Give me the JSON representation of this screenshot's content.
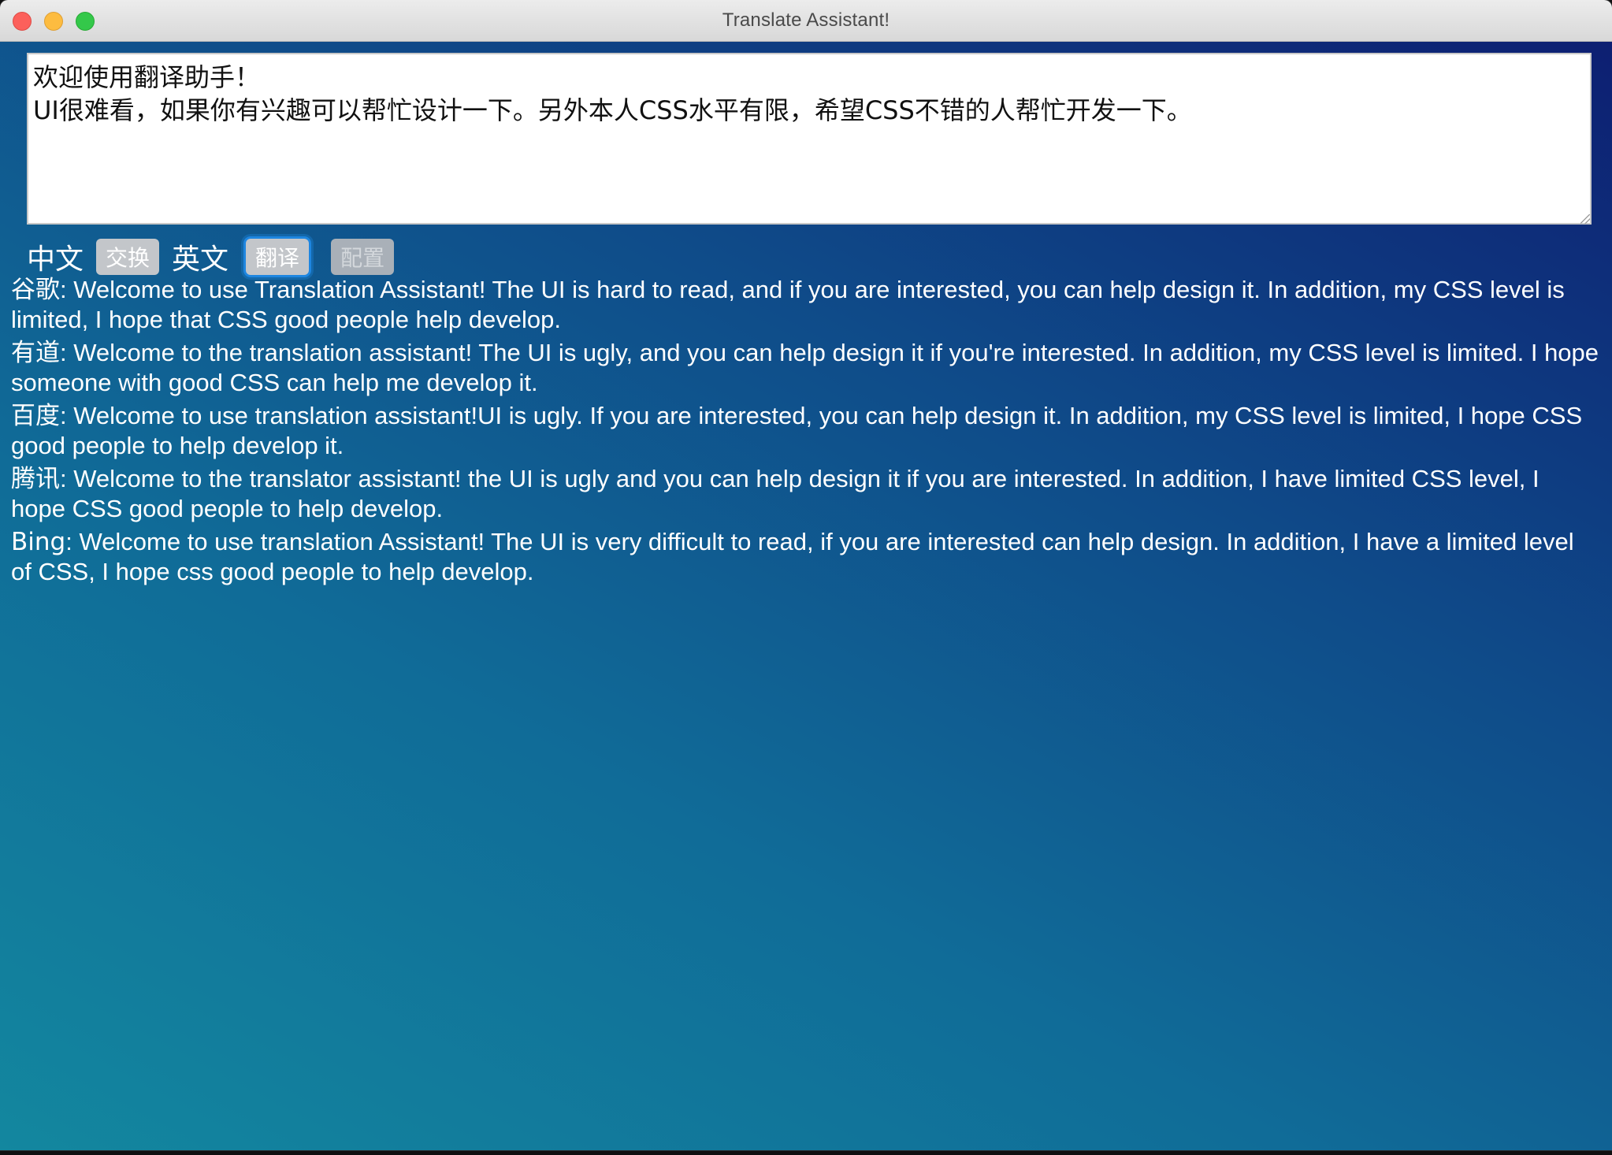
{
  "window": {
    "title": "Translate Assistant!"
  },
  "input": {
    "text": "欢迎使用翻译助手！\nUI很难看，如果你有兴趣可以帮忙设计一下。另外本人CSS水平有限，希望CSS不错的人帮忙开发一下。"
  },
  "toolbar": {
    "source_lang": "中文",
    "swap_label": "交换",
    "target_lang": "英文",
    "translate_label": "翻译",
    "config_label": "配置"
  },
  "results": [
    {
      "engine": "谷歌",
      "text": ": Welcome to use Translation Assistant! The UI is hard to read, and if you are interested, you can help design it. In addition, my CSS level is limited, I hope that CSS good people help develop."
    },
    {
      "engine": "有道",
      "text": ": Welcome to the translation assistant! The UI is ugly, and you can help design it if you're interested. In addition, my CSS level is limited. I hope someone with good CSS can help me develop it."
    },
    {
      "engine": "百度",
      "text": ": Welcome to use translation assistant!UI is ugly. If you are interested, you can help design it. In addition, my CSS level is limited, I hope CSS good people to help develop it."
    },
    {
      "engine": "腾讯",
      "text": ": Welcome to the translator assistant! the UI is ugly and you can help design it if you are interested. In addition, I have limited CSS level, I hope CSS good people to help develop."
    },
    {
      "engine": "Bing",
      "text": ": Welcome to use translation Assistant! The UI is very difficult to read, if you are interested can help design. In addition, I have a limited level of CSS, I hope css good people to help develop."
    }
  ],
  "colors": {
    "gradient_start": "#13879f",
    "gradient_end": "#0d1f72",
    "focus_ring": "#1e86e0",
    "button_bg": "#c3c6ca"
  }
}
